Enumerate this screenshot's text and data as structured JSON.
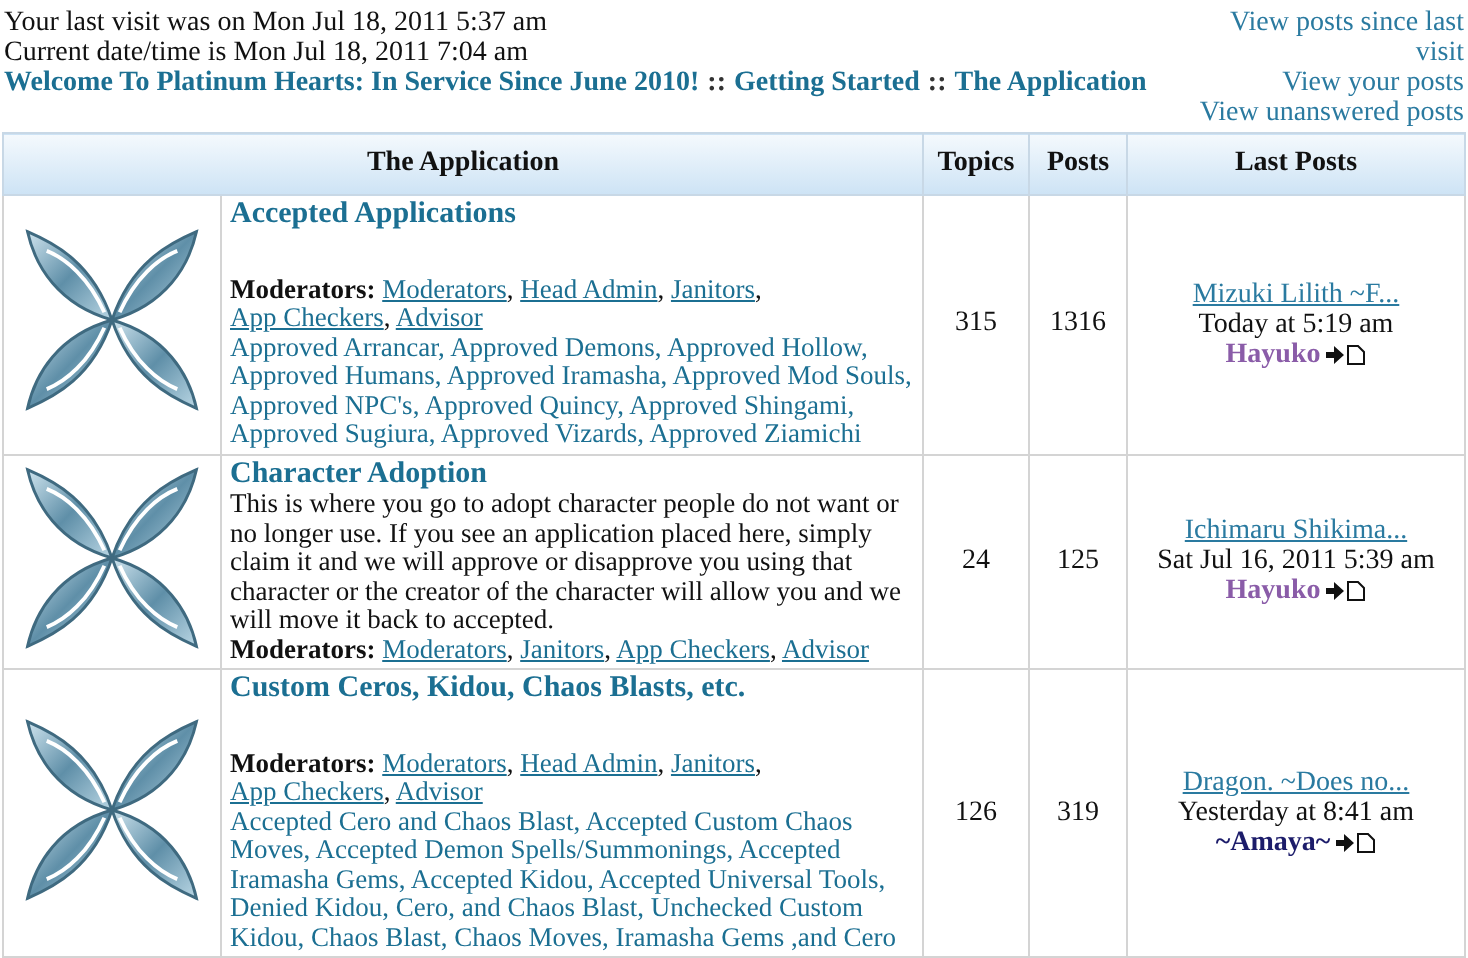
{
  "visit": {
    "last_visit": "Your last visit was on Mon Jul 18, 2011 5:37 am",
    "current_time": "Current date/time is Mon Jul 18, 2011 7:04 am"
  },
  "breadcrumbs": {
    "items": [
      "Welcome To Platinum Hearts: In Service Since June 2010!",
      "Getting Started",
      "The Application"
    ],
    "separator": "::"
  },
  "quick_links": [
    "View posts since last visit",
    "View your posts",
    "View unanswered posts"
  ],
  "table": {
    "columns": [
      "The Application",
      "Topics",
      "Posts",
      "Last Posts"
    ],
    "separator": ", ",
    "rows": [
      {
        "title": "Accepted Applications",
        "moderators_label": "Moderators:",
        "moderators": [
          "Moderators",
          "Head Admin",
          "Janitors",
          "App Checkers",
          "Advisor"
        ],
        "subforums": [
          "Approved Arrancar",
          "Approved Demons",
          "Approved Hollow",
          "Approved Humans",
          "Approved Iramasha",
          "Approved Mod Souls",
          "Approved NPC's",
          "Approved Quincy",
          "Approved Shingami",
          "Approved Sugiura",
          "Approved Vizards",
          "Approved Ziamichi"
        ],
        "topics": "315",
        "posts": "1316",
        "last_post": {
          "topic": "Mizuki Lilith ~F...",
          "time": "Today at 5:19 am",
          "user": "Hayuko",
          "color": "#8a5ca8"
        }
      },
      {
        "title": "Character Adoption",
        "description": "This is where you go to adopt character people do not want or no longer use. If you see an application placed here, simply claim it and we will approve or disapprove you using that character or the creator of the character will allow you and we will move it back to accepted.",
        "moderators_label": "Moderators:",
        "moderators": [
          "Moderators",
          "Janitors",
          "App Checkers",
          "Advisor"
        ],
        "topics": "24",
        "posts": "125",
        "last_post": {
          "topic": "Ichimaru Shikima...",
          "time": "Sat Jul 16, 2011 5:39 am",
          "user": "Hayuko",
          "color": "#8a5ca8"
        }
      },
      {
        "title": "Custom Ceros, Kidou, Chaos Blasts, etc.",
        "moderators_label": "Moderators:",
        "moderators": [
          "Moderators",
          "Head Admin",
          "Janitors",
          "App Checkers",
          "Advisor"
        ],
        "subforums": [
          "Accepted Cero and Chaos Blast",
          "Accepted Custom Chaos Moves",
          "Accepted Demon Spells/Summonings",
          "Accepted Iramasha Gems",
          "Accepted Kidou",
          "Accepted Universal Tools",
          "Denied Kidou, Cero, and Chaos Blast",
          "Unchecked Custom Kidou, Chaos Blast, Chaos Moves, Iramasha Gems ,and Cero"
        ],
        "topics": "126",
        "posts": "319",
        "last_post": {
          "topic": "Dragon. ~Does no...",
          "time": "Yesterday at 8:41 am",
          "user": "~Amaya~",
          "color": "#1c1c6a"
        }
      }
    ]
  }
}
